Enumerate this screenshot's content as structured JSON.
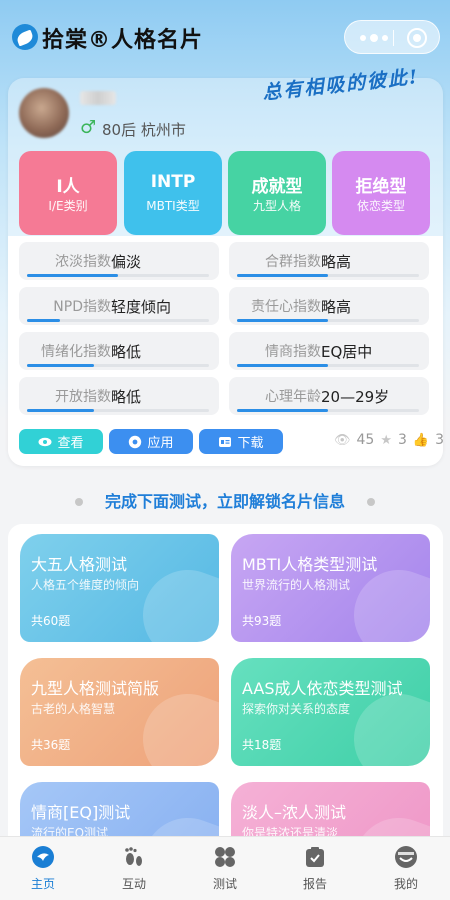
{
  "header": {
    "title": "拾棠®人格名片",
    "slogan": "总有相吸的彼此!"
  },
  "profile": {
    "gender_symbol": "♂",
    "meta": "80后 杭州市"
  },
  "type_tiles": [
    {
      "value": "I人",
      "caption": "I/E类别",
      "color": "#f57a95"
    },
    {
      "value": "INTP",
      "caption": "MBTI类型",
      "color": "#3fc1ec"
    },
    {
      "value": "成就型",
      "caption": "九型人格",
      "color": "#46d3a3"
    },
    {
      "value": "拒绝型",
      "caption": "依恋类型",
      "color": "#d58af0"
    }
  ],
  "indices": [
    {
      "label": "浓淡指数",
      "value": "偏淡",
      "level": 0.5
    },
    {
      "label": "合群指数",
      "value": "略高",
      "level": 0.5
    },
    {
      "label": "NPD指数",
      "value": "轻度倾向",
      "level": 0.18
    },
    {
      "label": "责任心指数",
      "value": "略高",
      "level": 0.5
    },
    {
      "label": "情绪化指数",
      "value": "略低",
      "level": 0.37
    },
    {
      "label": "情商指数",
      "value": "EQ居中",
      "level": 0.5
    },
    {
      "label": "开放指数",
      "value": "略低",
      "level": 0.37
    },
    {
      "label": "心理年龄",
      "value": "20—29岁",
      "level": 0.5
    }
  ],
  "actions": {
    "view": "查看",
    "apply": "应用",
    "download": "下载"
  },
  "stats": {
    "views": "45",
    "stars": "3",
    "likes": "3"
  },
  "banner": "完成下面测试，立即解锁名片信息",
  "tests": [
    {
      "title": "大五人格测试",
      "subtitle": "人格五个维度的倾向",
      "count": "共60题",
      "color_from": "#7fd0ec",
      "color_to": "#55b8e4"
    },
    {
      "title": "MBTI人格类型测试",
      "subtitle": "世界流行的人格测试",
      "count": "共93题",
      "color_from": "#c7a6f3",
      "color_to": "#a485ec"
    },
    {
      "title": "九型人格测试简版",
      "subtitle": "古老的人格智慧",
      "count": "共36题",
      "color_from": "#f4bf95",
      "color_to": "#eea27a"
    },
    {
      "title": "AAS成人依恋类型测试",
      "subtitle": "探索你对关系的态度",
      "count": "共18题",
      "color_from": "#66e0bf",
      "color_to": "#3fcfa7"
    },
    {
      "title": "情商[EQ]测试",
      "subtitle": "流行的EQ测试",
      "count": "",
      "color_from": "#a5c7f7",
      "color_to": "#85aef0"
    },
    {
      "title": "淡人–浓人测试",
      "subtitle": "你是特浓还是清淡",
      "count": "",
      "color_from": "#f5b1d6",
      "color_to": "#ee95c6"
    }
  ],
  "tabs": [
    {
      "label": "主页",
      "icon": "home-icon",
      "active": true
    },
    {
      "label": "互动",
      "icon": "footprint-icon",
      "active": false
    },
    {
      "label": "测试",
      "icon": "grid-icon",
      "active": false
    },
    {
      "label": "报告",
      "icon": "report-icon",
      "active": false
    },
    {
      "label": "我的",
      "icon": "profile-icon",
      "active": false
    }
  ]
}
